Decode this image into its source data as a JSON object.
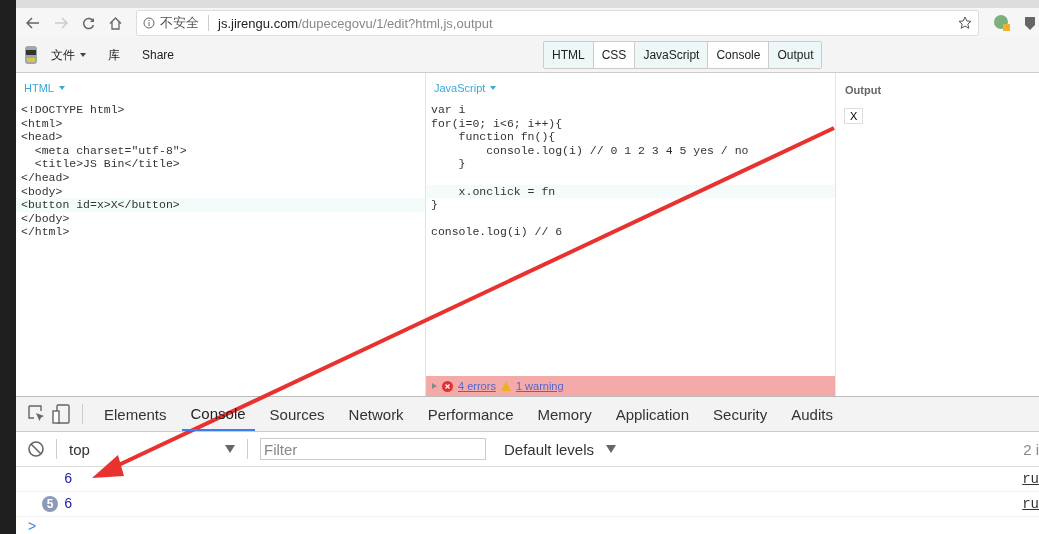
{
  "browser": {
    "security_label": "不安全",
    "host": "js.jirengu.com",
    "path": "/dupecegovu/1/edit?html,js,output"
  },
  "jsbin_toolbar": {
    "menu": [
      {
        "label": "文件",
        "has_caret": true
      },
      {
        "label": "库",
        "has_caret": false
      },
      {
        "label": "Share",
        "has_caret": false
      }
    ],
    "panel_tabs": [
      {
        "label": "HTML",
        "selected": true
      },
      {
        "label": "CSS",
        "selected": false
      },
      {
        "label": "JavaScript",
        "selected": true
      },
      {
        "label": "Console",
        "selected": false
      },
      {
        "label": "Output",
        "selected": true
      }
    ]
  },
  "html_panel": {
    "title": "HTML",
    "lines": [
      {
        "active": false,
        "text": "<!DOCTYPE html>"
      },
      {
        "active": false,
        "text": "<html>"
      },
      {
        "active": false,
        "text": "<head>"
      },
      {
        "active": false,
        "text": "  <meta charset=\"utf-8\">"
      },
      {
        "active": false,
        "text": "  <title>JS Bin</title>"
      },
      {
        "active": false,
        "text": "</head>"
      },
      {
        "active": false,
        "text": "<body>"
      },
      {
        "active": true,
        "text": "<button id=x>X</button>"
      },
      {
        "active": false,
        "text": "</body>"
      },
      {
        "active": false,
        "text": "</html>"
      }
    ]
  },
  "js_panel": {
    "title": "JavaScript",
    "lines": [
      {
        "active": false,
        "text": "var i"
      },
      {
        "active": false,
        "text": "for(i=0; i<6; i++){"
      },
      {
        "active": false,
        "text": "    function fn(){"
      },
      {
        "active": false,
        "text": "        console.log(i) // 0 1 2 3 4 5 yes / no"
      },
      {
        "active": false,
        "text": "    }"
      },
      {
        "active": false
      },
      {
        "active": true,
        "text": "    x.onclick = fn"
      },
      {
        "active": false,
        "text": "}"
      },
      {
        "active": false
      },
      {
        "active": false,
        "text": "console.log(i) // 6"
      }
    ],
    "status": {
      "errors": "4 errors",
      "warning": "1 warning"
    }
  },
  "output_panel": {
    "title": "Output",
    "button": "X"
  },
  "devtools": {
    "tabs": [
      {
        "label": "Elements",
        "selected": false
      },
      {
        "label": "Console",
        "selected": true
      },
      {
        "label": "Sources",
        "selected": false
      },
      {
        "label": "Network",
        "selected": false
      },
      {
        "label": "Performance",
        "selected": false
      },
      {
        "label": "Memory",
        "selected": false
      },
      {
        "label": "Application",
        "selected": false
      },
      {
        "label": "Security",
        "selected": false
      },
      {
        "label": "Audits",
        "selected": false
      }
    ],
    "context": "top",
    "filter_placeholder": "Filter",
    "levels": "Default levels",
    "count": "2 i",
    "messages": [
      {
        "value": "6",
        "source": "ru"
      },
      {
        "value": "6",
        "repeat": "5",
        "source": "ru"
      }
    ],
    "prompt": ">"
  }
}
